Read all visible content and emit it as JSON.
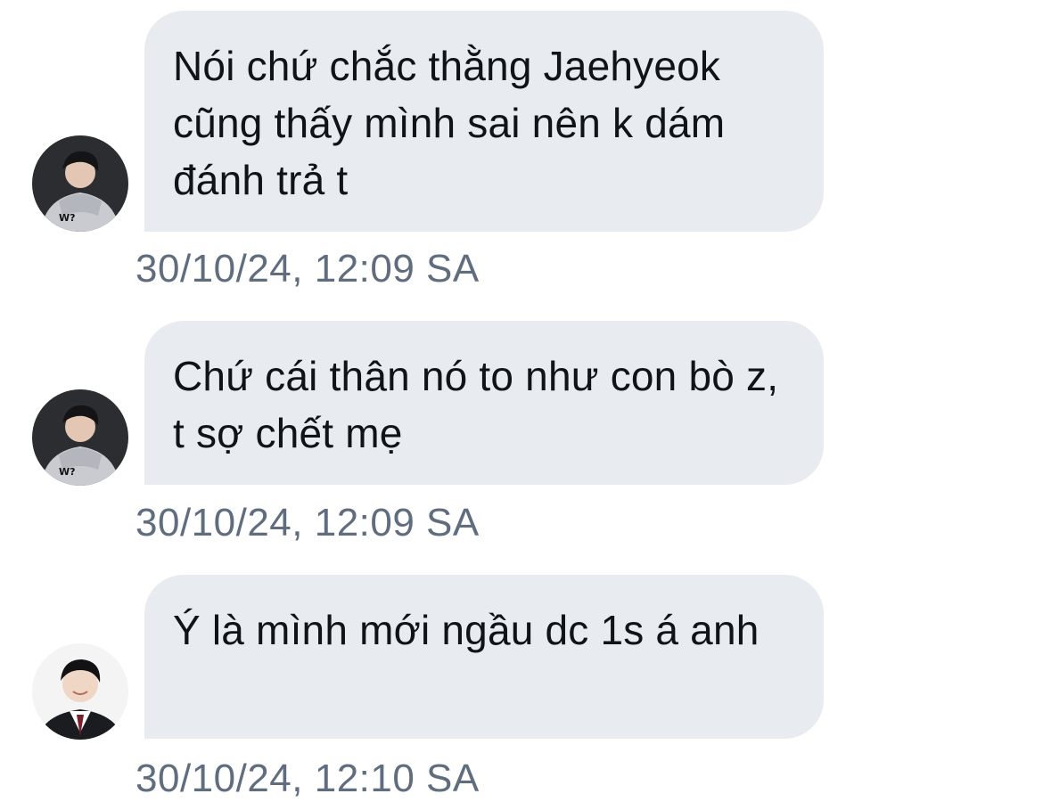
{
  "messages": [
    {
      "avatar": "gray-hoodie-avatar",
      "text": "Nói chứ chắc thằng Jaehyeok cũng thấy mình sai nên k dám đánh trả t",
      "timestamp": "30/10/24, 12:09 SA"
    },
    {
      "avatar": "gray-hoodie-avatar",
      "text": "Chứ cái thân nó to như con bò z, t sợ chết mẹ",
      "timestamp": "30/10/24, 12:09 SA"
    },
    {
      "avatar": "school-uniform-avatar",
      "text": "Ý là mình mới ngầu dc 1s á anh",
      "timestamp": "30/10/24, 12:10 SA"
    }
  ],
  "colors": {
    "bubble_background": "#e8ebef",
    "message_text": "#0f1419",
    "timestamp_text": "#5f6d7e"
  }
}
